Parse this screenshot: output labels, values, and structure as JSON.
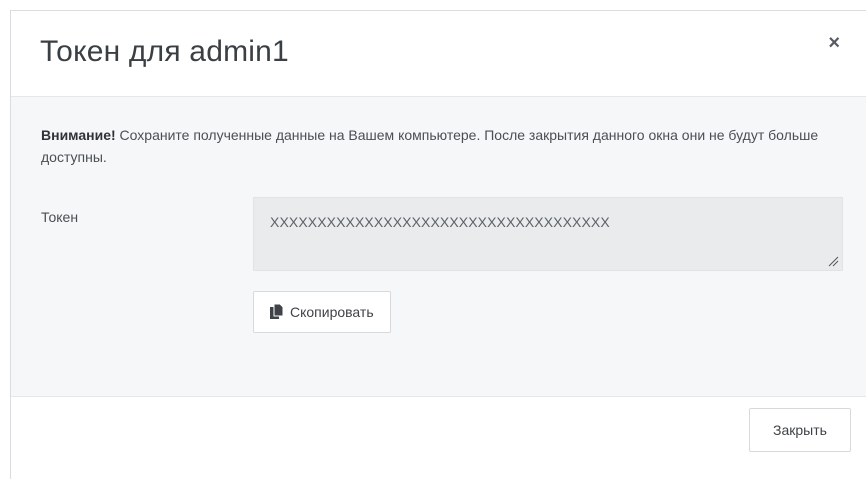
{
  "modal": {
    "title": "Токен для admin1",
    "close_symbol": "×",
    "warning_bold": "Внимание!",
    "warning_text": " Сохраните полученные данные на Вашем компьютере. После закрытия данного окна они не будут больше доступны.",
    "token_label": "Токен",
    "token_value": "XXXXXXXXXXXXXXXXXXXXXXXXXXXXXXXXXXXX",
    "copy_label": "Скопировать",
    "copy_icon": "copy-icon",
    "close_label": "Закрыть"
  }
}
